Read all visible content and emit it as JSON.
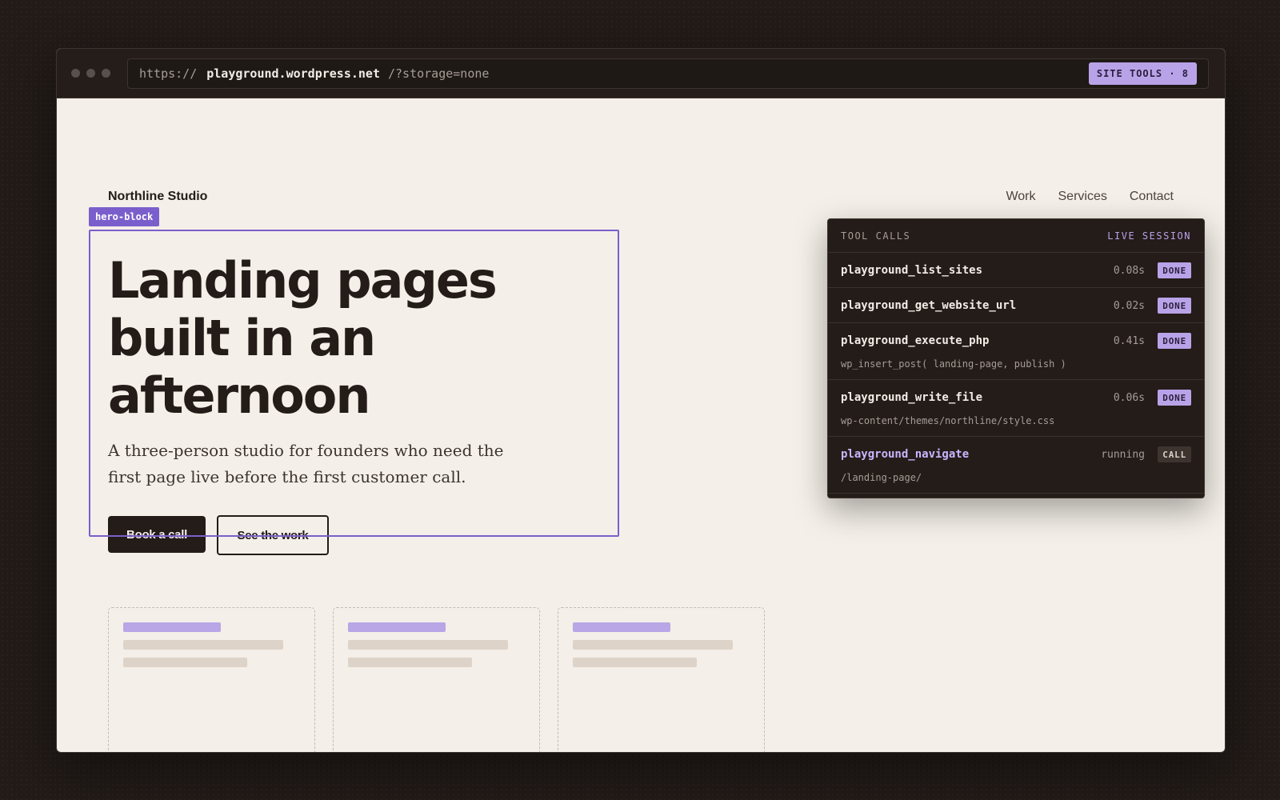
{
  "browser": {
    "url_scheme": "https://",
    "url_host": "playground.wordpress.net",
    "url_path": "/?storage=none",
    "site_tools_label": "SITE TOOLS · 8"
  },
  "site": {
    "brand": "Northline Studio",
    "nav": [
      "Work",
      "Services",
      "Contact"
    ],
    "hero_tag": "hero-block",
    "hero_title": "Landing pages built in an afternoon",
    "hero_subtitle": "A three-person studio for founders who need the first page live before the first customer call.",
    "primary_cta": "Book a call",
    "secondary_cta": "See the work"
  },
  "tool_panel": {
    "title": "TOOL CALLS",
    "status": "LIVE SESSION",
    "calls": [
      {
        "name": "playground_list_sites",
        "time": "0.08s",
        "badge": "DONE"
      },
      {
        "name": "playground_get_website_url",
        "time": "0.02s",
        "badge": "DONE"
      },
      {
        "name": "playground_execute_php",
        "time": "0.41s",
        "badge": "DONE",
        "detail": "wp_insert_post( landing-page, publish )"
      },
      {
        "name": "playground_write_file",
        "time": "0.06s",
        "badge": "DONE",
        "detail": "wp-content/themes/northline/style.css"
      },
      {
        "name": "playground_navigate",
        "time": "running",
        "badge": "CALL",
        "detail": "/landing-page/"
      }
    ]
  },
  "colors": {
    "accent": "#7a5fcc",
    "accent_light": "#b9a3e8",
    "page_bg": "#f4efe8",
    "dark": "#231c19"
  }
}
